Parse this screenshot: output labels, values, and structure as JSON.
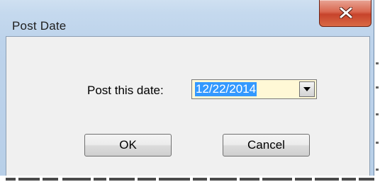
{
  "window": {
    "title": "Post Date"
  },
  "form": {
    "date_label": "Post this date:",
    "date_value": "12/22/2014"
  },
  "buttons": {
    "ok_label": "OK",
    "cancel_label": "Cancel"
  },
  "icons": {
    "close": "close-icon",
    "dropdown": "chevron-down-icon"
  },
  "colors": {
    "selection": "#3399ff",
    "date_field_background": "#fff8d6",
    "close_button": "#c7432b"
  }
}
